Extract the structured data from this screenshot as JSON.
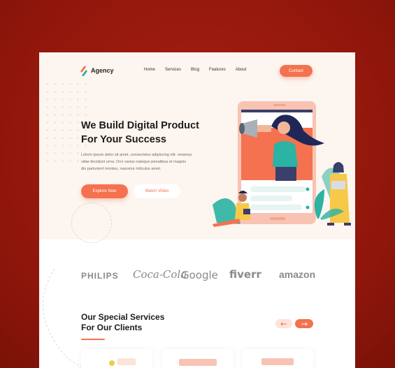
{
  "brand": {
    "name": "Agency"
  },
  "nav": {
    "items": [
      {
        "label": "Home"
      },
      {
        "label": "Services"
      },
      {
        "label": "Blog"
      },
      {
        "label": "Features"
      },
      {
        "label": "About"
      }
    ],
    "contact_label": "Contact"
  },
  "hero": {
    "headline_line1": "We Build Digital Product",
    "headline_line2": "For Your Success",
    "body_line1": "Lorem ipsum dolor sit amet, consectetur adipiscing elit. vivamus",
    "body_line2": "vitae tincidunt urna. Orci varius natoque penatibus et magnis",
    "body_line3": "dis parturient montes, nascetur ridiculus amet.",
    "explore_label": "Explore Now",
    "watch_label": "Watch Video"
  },
  "partners": {
    "philips": "PHILIPS",
    "cocacola": "Coca-Cola",
    "google": "Google",
    "fiverr": "fiverr",
    "amazon": "amazon"
  },
  "services": {
    "title_line1": "Our Special Services",
    "title_line2": "For Our Clients"
  },
  "colors": {
    "accent": "#f4724f",
    "hero_bg": "#fdf5ef",
    "outer_bg": "#9c1a0d"
  }
}
